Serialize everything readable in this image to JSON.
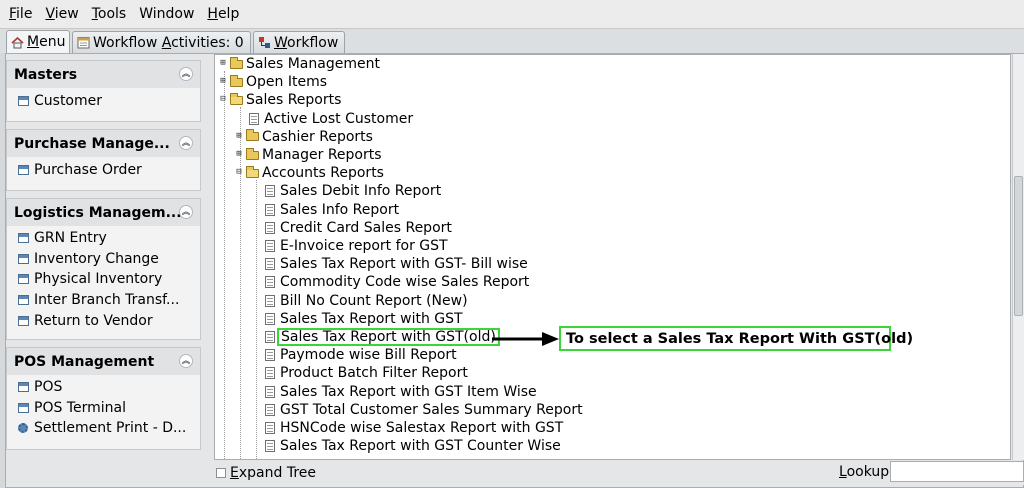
{
  "menubar": [
    {
      "label": "File",
      "accel": "F",
      "rest": "ile"
    },
    {
      "label": "View",
      "accel": "V",
      "rest": "iew"
    },
    {
      "label": "Tools",
      "accel": "T",
      "rest": "ools"
    },
    {
      "label": "Window",
      "accel": "",
      "rest": "Window"
    },
    {
      "label": "Help",
      "accel": "H",
      "rest": "elp"
    }
  ],
  "tabs": {
    "menu": {
      "accel": "M",
      "rest": "enu"
    },
    "activities": {
      "pre": "Workflow ",
      "accel": "A",
      "post": "ctivities: 0"
    },
    "workflow": {
      "accel": "W",
      "rest": "orkflow"
    }
  },
  "sidebar": {
    "masters": {
      "title": "Masters",
      "items": [
        "Customer"
      ]
    },
    "purchase": {
      "title": "Purchase Manage...",
      "items": [
        "Purchase Order"
      ]
    },
    "logistics": {
      "title": "Logistics Managem...",
      "items": [
        "GRN Entry",
        "Inventory Change",
        "Physical Inventory",
        "Inter Branch Transf...",
        "Return to Vendor"
      ]
    },
    "pos": {
      "title": "POS Management",
      "items": [
        "POS",
        "POS Terminal",
        "Settlement Print - D..."
      ]
    }
  },
  "tree": {
    "sales_management": "Sales Management",
    "open_items": "Open Items",
    "sales_reports": "Sales Reports",
    "active_lost_customer": "Active Lost Customer",
    "cashier_reports": "Cashier Reports",
    "manager_reports": "Manager Reports",
    "accounts_reports": "Accounts Reports",
    "reports": [
      "Sales Debit Info Report",
      "Sales Info Report",
      "Credit Card Sales Report",
      "E-Invoice report for GST",
      "Sales Tax Report with GST- Bill wise",
      "Commodity Code wise Sales Report",
      "Bill No Count Report (New)",
      "Sales Tax Report with GST",
      "Sales Tax Report with GST(old)",
      "Paymode wise Bill Report",
      "Product Batch Filter Report",
      "Sales Tax Report with GST Item Wise",
      "GST Total Customer Sales Summary Report",
      "HSNCode wise Salestax Report with GST",
      "Sales Tax Report with GST Counter Wise"
    ]
  },
  "annotation": {
    "text": "To select a Sales Tax Report With GST(old)",
    "highlight_color": "#3bd43b"
  },
  "bottom": {
    "expand_accel": "E",
    "expand_rest": "xpand Tree",
    "lookup_accel": "L",
    "lookup_rest": "ookup",
    "lookup_value": ""
  }
}
